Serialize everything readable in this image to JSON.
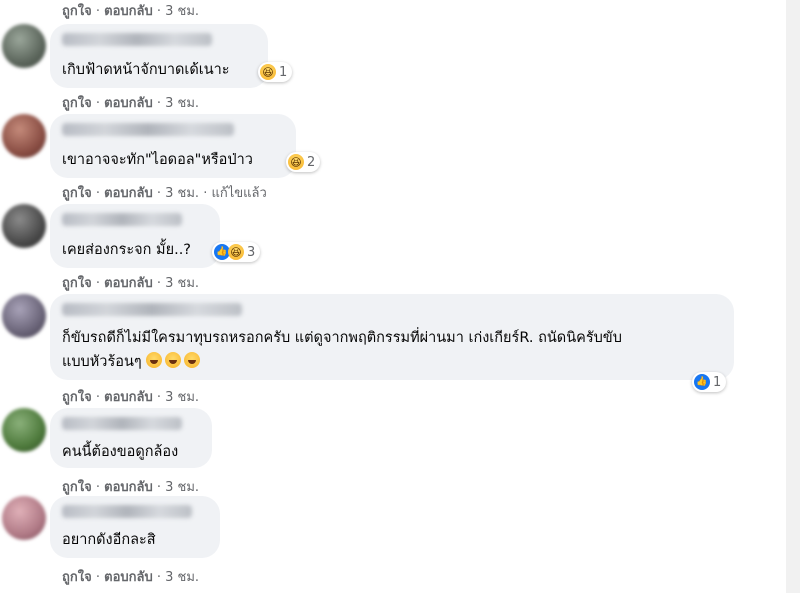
{
  "labels": {
    "like": "ถูกใจ",
    "reply": "ตอบกลับ",
    "edited": "แก้ไขแล้ว"
  },
  "top_actions": {
    "time": "3 ชม."
  },
  "comments": [
    {
      "text": "เกิบฟ้าดหน้าจักบาดเด้เนาะ",
      "reaction_count": "1",
      "reaction_icons": [
        "haha-icon"
      ],
      "time": "3 ชม."
    },
    {
      "text": "เขาอาจจะทัก\"ไอดอล\"หรือป่าว",
      "reaction_count": "2",
      "reaction_icons": [
        "haha-icon"
      ],
      "time": "3 ชม."
    },
    {
      "text": "เคยส่องกระจก มั้ย..?",
      "reaction_count": "3",
      "reaction_icons": [
        "like-icon",
        "haha-icon"
      ],
      "time": "3 ชม."
    },
    {
      "text_line1": "ก็ขับรถดีก็ไม่มีใครมาทุบรถหรอกครับ แต่ดูจากพฤติกรรมที่ผ่านมา เก่งเกียร์R. ถนัดนิครับขับ",
      "text_line2": "แบบหัวร้อนๆ",
      "reaction_count": "1",
      "reaction_icons": [
        "like-icon"
      ],
      "time": "3 ชม."
    },
    {
      "text": "คนนี้ต้องขอดูกล้อง",
      "time": "3 ชม."
    },
    {
      "text": "อยากดังอีกละสิ",
      "time": "3 ชม."
    }
  ],
  "colors": {
    "bubble": "#f0f2f5",
    "secondary_text": "#65676b",
    "like_blue": "#1877f2",
    "haha_yellow": "#f7b125"
  }
}
